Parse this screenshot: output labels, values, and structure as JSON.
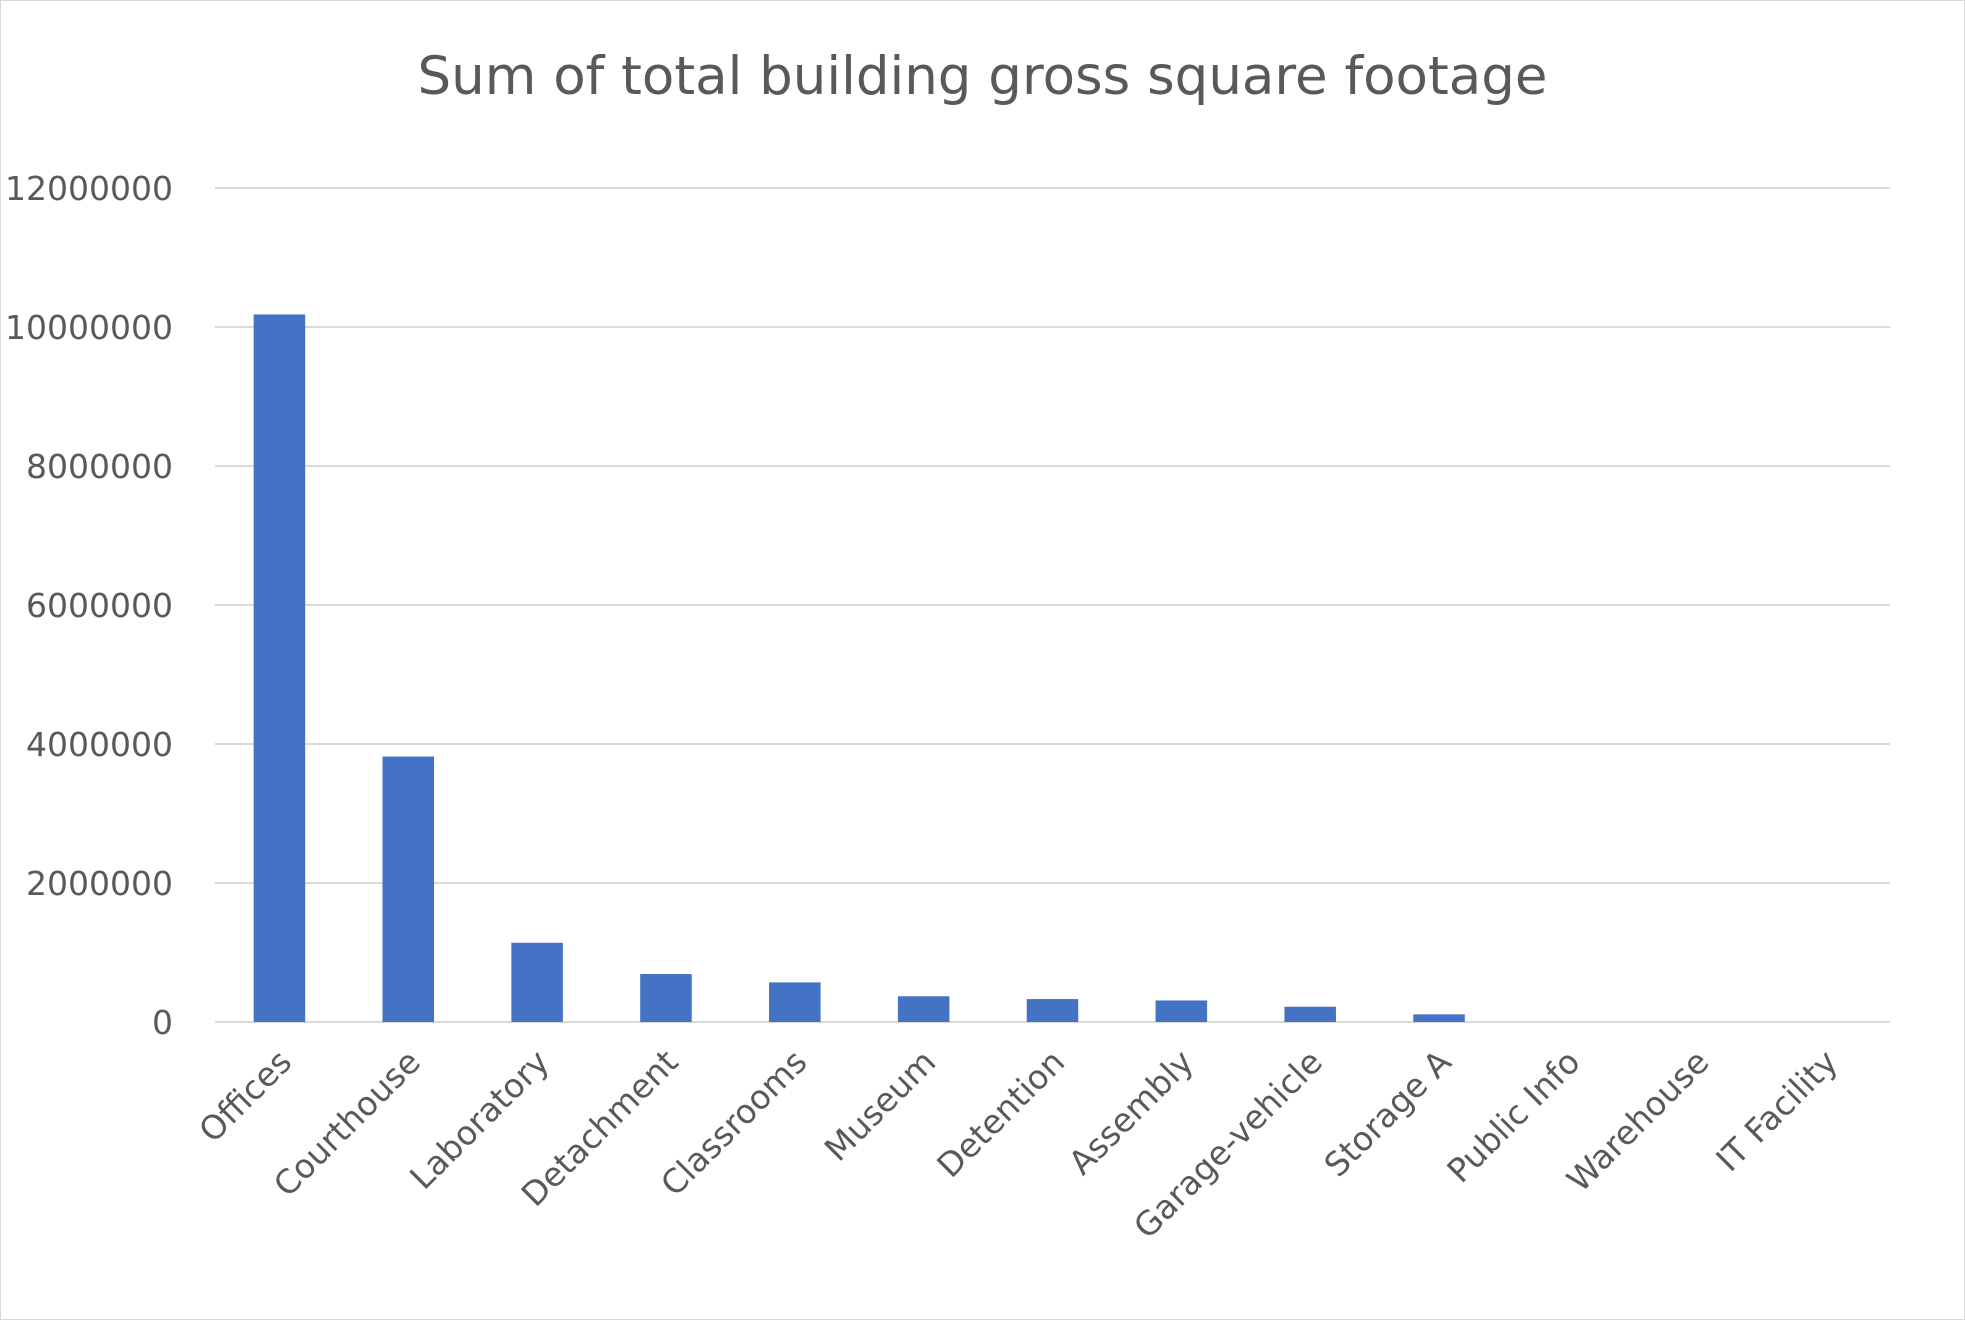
{
  "chart_data": {
    "type": "bar",
    "title": "Sum of total building gross square footage",
    "xlabel": "",
    "ylabel": "",
    "categories": [
      "Offices",
      "Courthouse",
      "Laboratory",
      "Detachment",
      "Classrooms",
      "Museum",
      "Detention",
      "Assembly",
      "Garage-vehicle",
      "Storage A",
      "Public Info",
      "Warehouse",
      "IT Facility"
    ],
    "values": [
      10180000,
      3820000,
      1140000,
      690000,
      570000,
      370000,
      330000,
      310000,
      220000,
      110000,
      0,
      0,
      0
    ],
    "ylim": [
      0,
      12000000
    ],
    "yticks": [
      "0",
      "2000000",
      "4000000",
      "6000000",
      "8000000",
      "10000000",
      "12000000"
    ],
    "grid": true,
    "legend": "none",
    "bar_color": "#4472C4"
  }
}
